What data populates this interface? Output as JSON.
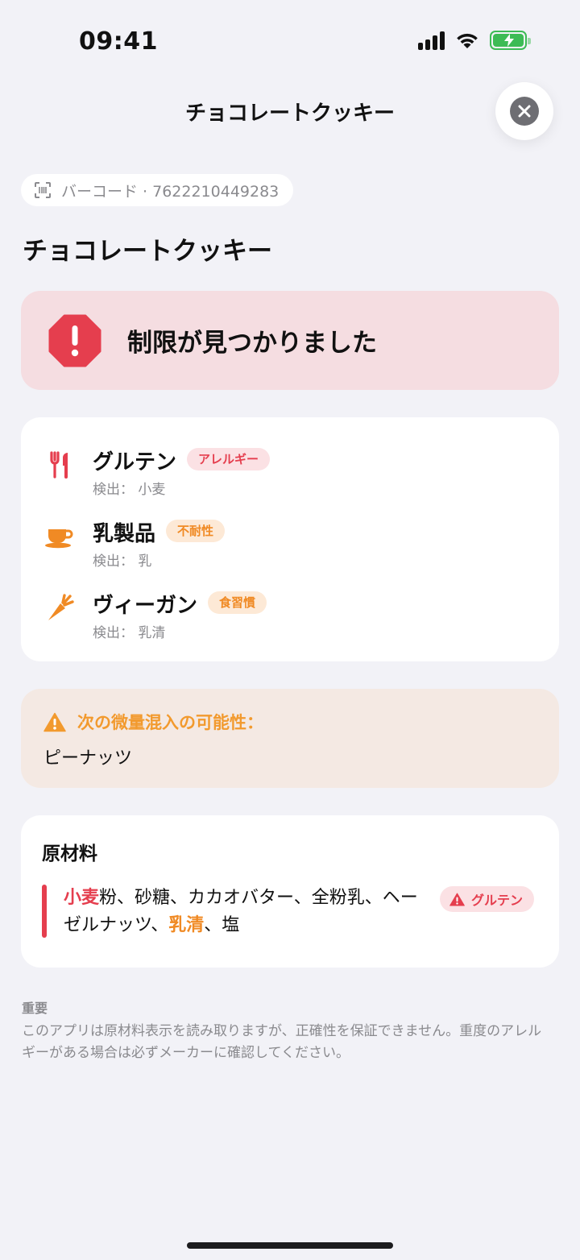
{
  "status_bar": {
    "time": "09:41"
  },
  "header": {
    "title": "チョコレートクッキー"
  },
  "barcode": {
    "label": "バーコード · 7622210449283"
  },
  "product": {
    "name": "チョコレートクッキー"
  },
  "alert": {
    "text": "制限が見つかりました",
    "color": "#e53e4e"
  },
  "restrictions": [
    {
      "name": "グルテン",
      "badge": "アレルギー",
      "detected": "検出： 小麦",
      "icon": "fork-knife-icon"
    },
    {
      "name": "乳製品",
      "badge": "不耐性",
      "detected": "検出： 乳",
      "icon": "cup-icon"
    },
    {
      "name": "ヴィーガン",
      "badge": "食習慣",
      "detected": "検出： 乳清",
      "icon": "carrot-icon"
    }
  ],
  "trace": {
    "heading": "次の微量混入の可能性：",
    "items": "ピーナッツ"
  },
  "ingredients": {
    "title": "原材料",
    "parts": [
      "小麦",
      "粉、砂糖、カカオバター、全粉乳、ヘーゼルナッツ、",
      "乳清",
      "、塩"
    ],
    "badge": "グルテン"
  },
  "note": {
    "title": "重要",
    "body": "このアプリは原材料表示を読み取りますが、正確性を保証できません。重度のアレルギーがある場合は必ずメーカーに確認してください。"
  },
  "colors": {
    "danger": "#e53e4e",
    "warning": "#f08a24",
    "background": "#f2f2f7"
  }
}
